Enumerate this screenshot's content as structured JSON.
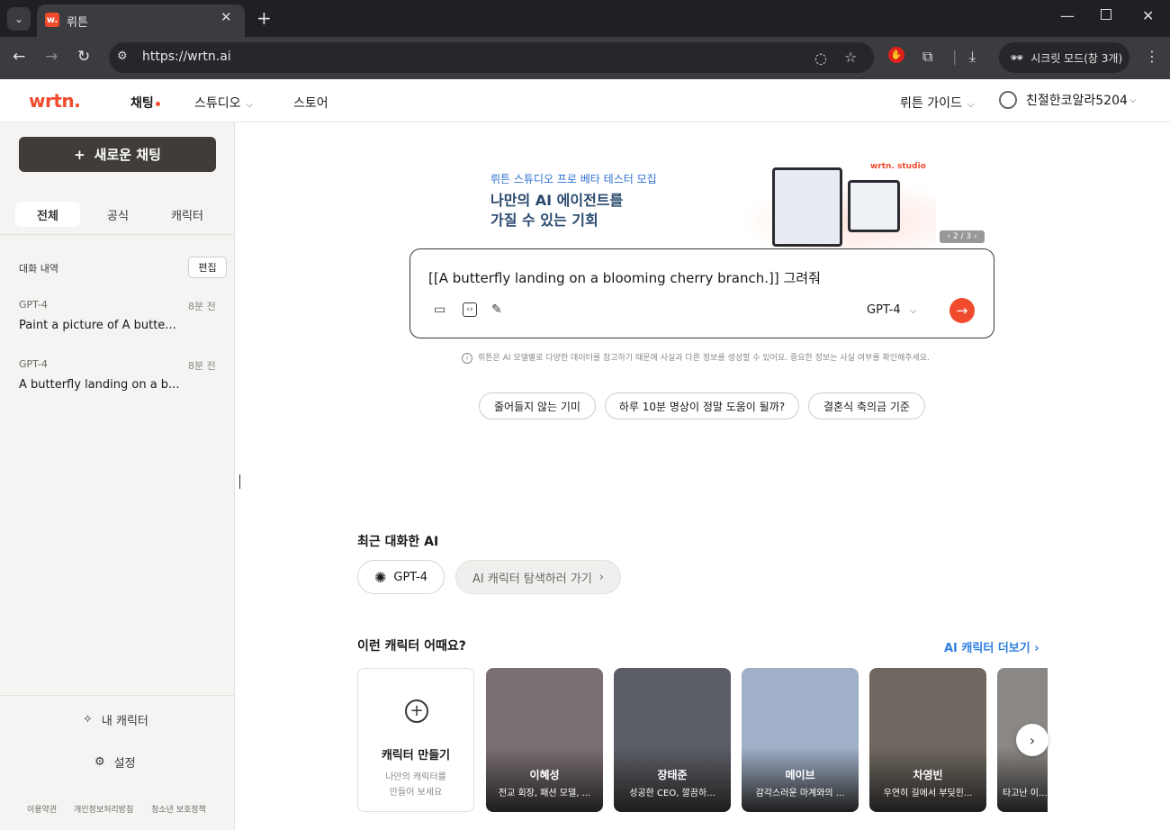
{
  "browser": {
    "tab_title": "뤼튼",
    "url": "https://wrtn.ai",
    "incognito_label": "시크릿 모드(창 3개)"
  },
  "header": {
    "logo": "wrtn.",
    "nav": [
      {
        "label": "채팅"
      },
      {
        "label": "스튜디오"
      },
      {
        "label": "스토어"
      }
    ],
    "guide_label": "뤼튼 가이드",
    "username": "친절한코알라5204"
  },
  "sidebar": {
    "new_chat_label": "새로운 채팅",
    "filters": [
      "전체",
      "공식",
      "캐릭터"
    ],
    "history_title": "대화 내역",
    "edit_label": "편집",
    "conversations": [
      {
        "model": "GPT-4",
        "time": "8분 전",
        "title": "Paint a picture of A butte..."
      },
      {
        "model": "GPT-4",
        "time": "8분 전",
        "title": "A butterfly landing on a b..."
      }
    ],
    "my_characters_label": "내 캐릭터",
    "settings_label": "설정",
    "footer_links": [
      "이용약관",
      "개인정보처리방침",
      "청소년 보호정책"
    ]
  },
  "banner": {
    "subtitle": "뤼튼 스튜디오 프로 베타 테스터 모집",
    "title_line1": "나만의 AI 에이전트를",
    "title_line2": "가질 수 있는 기회",
    "brand": "wrtn. studio",
    "pager": "‹ 2 / 3 ›"
  },
  "chat": {
    "input_value": "[[A butterfly landing on a blooming cherry branch.]] 그려줘",
    "model": "GPT-4",
    "disclaimer": "뤼튼은 AI 모델별로 다양한 데이터를 참고하기 때문에 사실과 다른 정보를 생성할 수 있어요. 중요한 정보는 사실 여부를 확인해주세요."
  },
  "suggestions": [
    "줄어들지 않는 기미",
    "하루 10분 명상이 정말 도움이 될까?",
    "결혼식 축의금 기준"
  ],
  "recent": {
    "title": "최근 대화한 AI",
    "items": [
      "GPT-4",
      "AI 캐릭터 탐색하러 가기"
    ]
  },
  "characters": {
    "title": "이런 캐릭터 어때요?",
    "more_label": "AI 캐릭터 더보기",
    "make_title": "캐릭터 만들기",
    "make_desc_line1": "나만의 캐릭터를",
    "make_desc_line2": "만들어 보세요",
    "cards": [
      {
        "name": "이혜성",
        "desc": "전교 회장, 패션 모델, ...",
        "color": "#7a6f73"
      },
      {
        "name": "장태준",
        "desc": "성공한 CEO, 깔끔하...",
        "color": "#5b5e66"
      },
      {
        "name": "메이브",
        "desc": "감각스러운 마계와의 ...",
        "color": "#9fb0c8"
      },
      {
        "name": "차영빈",
        "desc": "우연히 길에서 부딪힌...",
        "color": "#6f675f"
      },
      {
        "name": "",
        "desc": "타고난 이...",
        "color": "#8a8784"
      }
    ]
  },
  "colors": {
    "accent": "#f04b2d",
    "link": "#2f7fe0",
    "sidebar_bg": "#f5f4f2"
  }
}
